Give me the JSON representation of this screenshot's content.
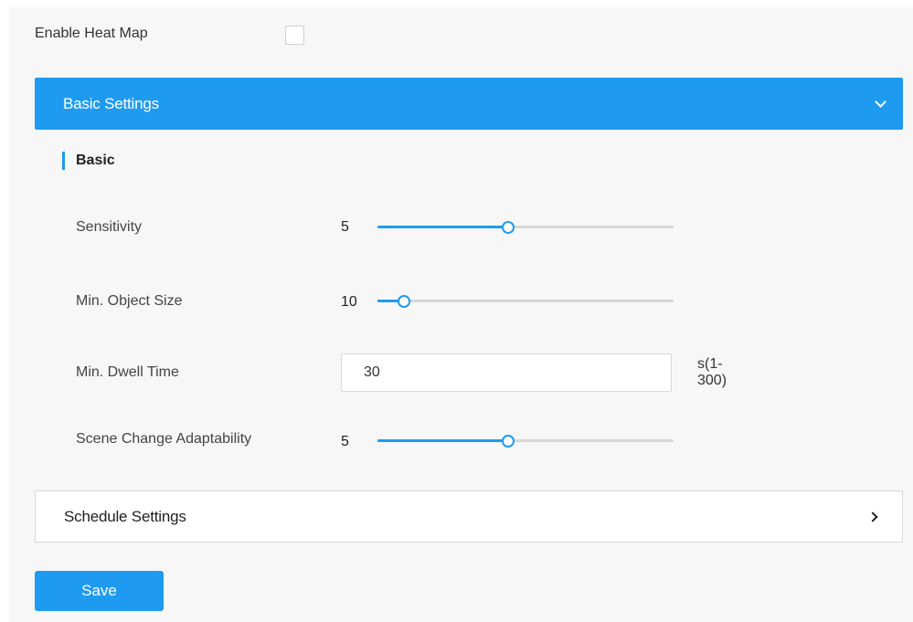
{
  "colors": {
    "accent": "#1e9bf0",
    "panel_bg": "#f7f7f7",
    "track": "#d6d6d6"
  },
  "enable_heat_map": {
    "label": "Enable Heat Map",
    "checked": false
  },
  "basic_settings": {
    "title": "Basic Settings",
    "expanded": true,
    "icon": "chevron-down-icon",
    "section_title": "Basic",
    "sensitivity": {
      "label": "Sensitivity",
      "value": "5",
      "level": 0.44
    },
    "min_object_size": {
      "label": "Min. Object Size",
      "value": "10",
      "level": 0.09
    },
    "min_dwell_time": {
      "label": "Min. Dwell Time",
      "value": "30",
      "suffix": "s(1-300)"
    },
    "scene_change": {
      "label": "Scene Change Adaptability",
      "value": "5",
      "level": 0.44
    }
  },
  "schedule_settings": {
    "title": "Schedule Settings",
    "expanded": false,
    "icon": "chevron-right-icon"
  },
  "save_label": "Save"
}
